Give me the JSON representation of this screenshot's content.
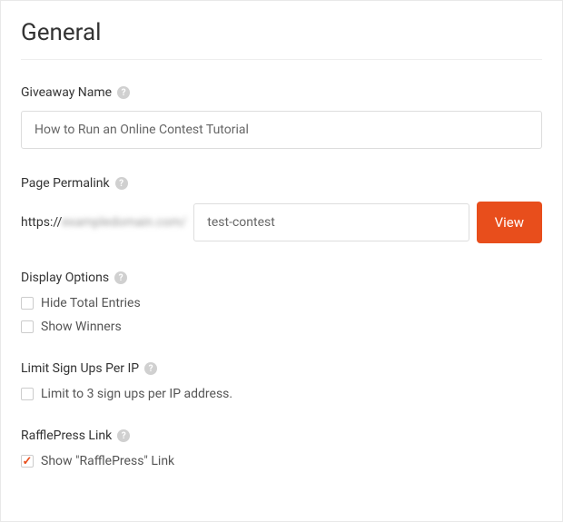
{
  "panel": {
    "title": "General"
  },
  "giveaway_name": {
    "label": "Giveaway Name",
    "value": "How to Run an Online Contest Tutorial"
  },
  "permalink": {
    "label": "Page Permalink",
    "prefix": "https://",
    "domain_blurred": "exampledomain.com/",
    "slug": "test-contest",
    "view_label": "View"
  },
  "display_options": {
    "label": "Display Options",
    "hide_total_entries": {
      "label": "Hide Total Entries",
      "checked": false
    },
    "show_winners": {
      "label": "Show Winners",
      "checked": false
    }
  },
  "limit_signups": {
    "label": "Limit Sign Ups Per IP",
    "option": {
      "label": "Limit to 3 sign ups per IP address.",
      "checked": false
    }
  },
  "rafflepress_link": {
    "label": "RafflePress Link",
    "option": {
      "label": "Show \"RafflePress\" Link",
      "checked": true
    }
  }
}
